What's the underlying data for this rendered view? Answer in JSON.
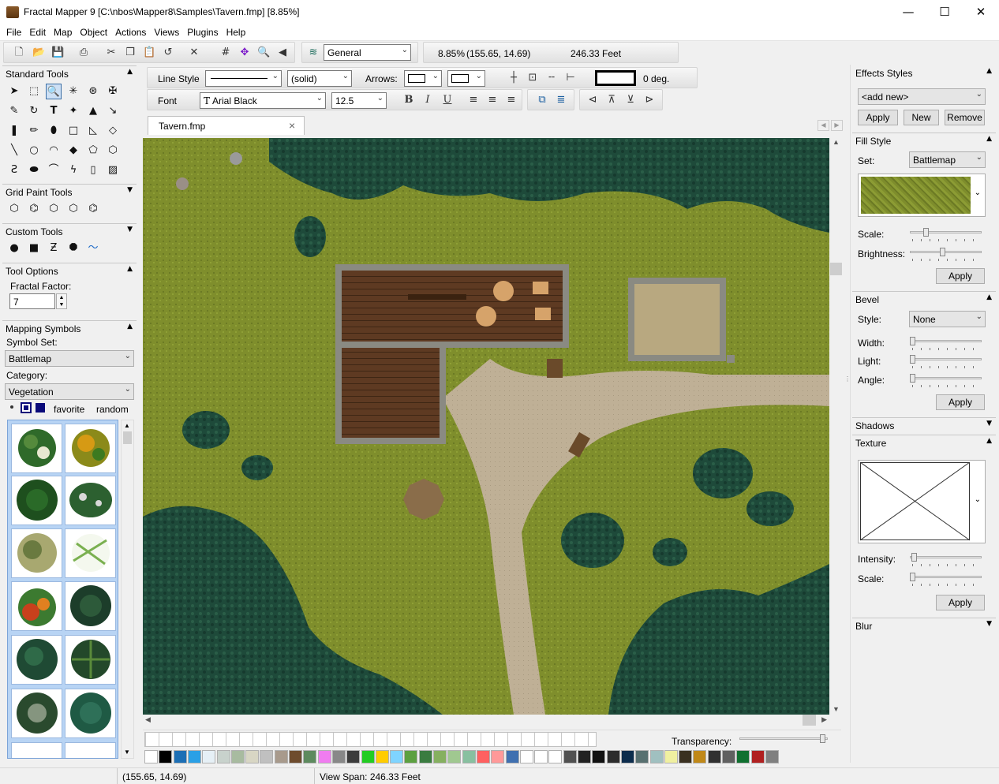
{
  "window": {
    "title": "Fractal Mapper 9 [C:\\nbos\\Mapper8\\Samples\\Tavern.fmp] [8.85%]",
    "minimize": "—",
    "maximize": "☐",
    "close": "✕"
  },
  "menu": [
    "File",
    "Edit",
    "Map",
    "Object",
    "Actions",
    "Views",
    "Plugins",
    "Help"
  ],
  "toolbar": {
    "layer": "General",
    "zoom": "8.85%",
    "coords": "(155.65, 14.69)",
    "span": "246.33 Feet"
  },
  "line_bar": {
    "line_style_label": "Line Style",
    "line_style_value": "(solid)",
    "arrows_label": "Arrows:",
    "rotation": "0 deg."
  },
  "font_bar": {
    "font_label": "Font",
    "font_name": "Arial Black",
    "font_size": "12.5",
    "bold": "B",
    "italic": "I",
    "underline": "U"
  },
  "tab": {
    "label": "Tavern.fmp",
    "close": "×"
  },
  "left": {
    "standard_tools": "Standard Tools",
    "grid_paint_tools": "Grid Paint Tools",
    "custom_tools": "Custom Tools",
    "tool_options": "Tool Options",
    "fractal_factor_label": "Fractal Factor:",
    "fractal_factor_value": "7",
    "mapping_symbols": "Mapping Symbols",
    "symbol_set_label": "Symbol Set:",
    "symbol_set_value": "Battlemap",
    "category_label": "Category:",
    "category_value": "Vegetation",
    "favorite": "favorite",
    "random": "random"
  },
  "right": {
    "effects_styles": "Effects Styles",
    "add_new": "<add new>",
    "apply": "Apply",
    "new": "New",
    "remove": "Remove",
    "fill_style": "Fill Style",
    "set_label": "Set:",
    "set_value": "Battlemap",
    "scale_label": "Scale:",
    "brightness_label": "Brightness:",
    "bevel": "Bevel",
    "style_label": "Style:",
    "style_value": "None",
    "width_label": "Width:",
    "light_label": "Light:",
    "angle_label": "Angle:",
    "shadows": "Shadows",
    "texture": "Texture",
    "intensity_label": "Intensity:",
    "texture_scale_label": "Scale:",
    "blur": "Blur",
    "levels": {
      "fill_scale": 0.2,
      "brightness": 0.45,
      "bevel_width": 0.0,
      "bevel_light": 0.0,
      "bevel_angle": 0.0,
      "intensity": 0.02,
      "texture_scale": 0.0
    }
  },
  "colorbar": {
    "transparency_label": "Transparency:",
    "transparency_level": 0.97,
    "colors": [
      "#ffffff",
      "#000000",
      "#1c6fb5",
      "#2aa0e6",
      "#e6f0f6",
      "#c8d2cc",
      "#a8bba0",
      "#d8d6c4",
      "#c0c0c0",
      "#a89a8c",
      "#6e4c2e",
      "#5d8a5e",
      "#f07cf0",
      "#888888",
      "#3c3c3c",
      "#22cc22",
      "#ffcc00",
      "#7fd4ff",
      "#5ca040",
      "#3a7c40",
      "#86b060",
      "#a0c890",
      "#88c0a0",
      "#ff6060",
      "#ff9999",
      "#4070b0",
      "#ffffff",
      "#ffffff",
      "#ffffff",
      "#505050",
      "#222222",
      "#111111",
      "#2c2c2c",
      "#0c2c4c",
      "#587070",
      "#a0c0c0",
      "#f0f0a0",
      "#3a3020",
      "#c08818",
      "#303030",
      "#606060",
      "#107030",
      "#b02020",
      "#808080"
    ]
  },
  "status": {
    "coords": "(155.65, 14.69)",
    "view_span": "View Span: 246.33 Feet"
  }
}
